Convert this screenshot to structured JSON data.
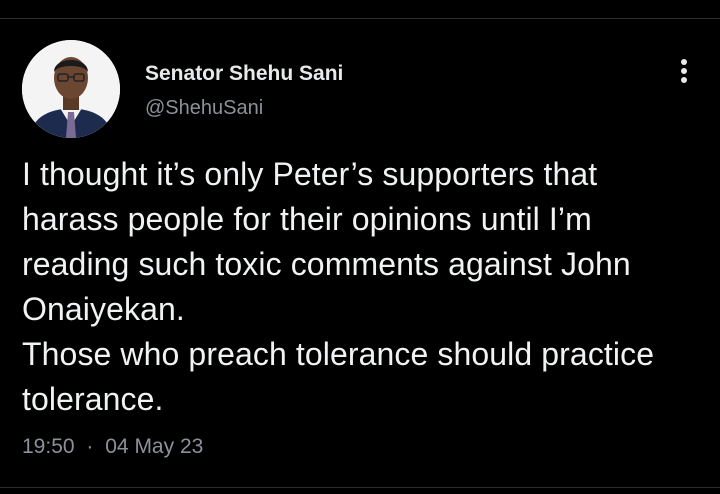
{
  "author": {
    "display_name": "Senator Shehu Sani",
    "handle": "@ShehuSani",
    "avatar_icon": "profile-photo-icon"
  },
  "menu": {
    "icon": "more-options-icon"
  },
  "tweet": {
    "text": "I thought it’s only Peter’s supporters that harass people for their opinions until I’m reading such toxic comments against John Onaiyekan.\nThose who preach tolerance should practice tolerance.",
    "time": "19:50",
    "separator": "·",
    "date": "04 May 23"
  },
  "colors": {
    "background": "#000000",
    "primary_text": "#e7e9ea",
    "secondary_text": "#8b9197",
    "divider": "#2a2d30"
  }
}
